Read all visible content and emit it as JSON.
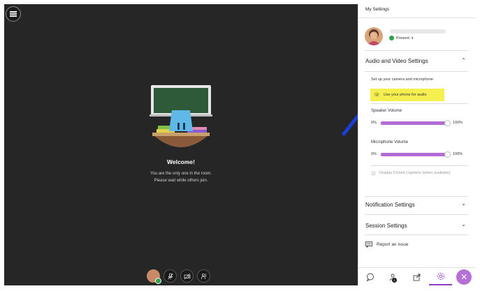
{
  "stage": {
    "welcome_title": "Welcome!",
    "welcome_line1": "You are the only one in the room.",
    "welcome_line2": "Please wait while others join."
  },
  "panel": {
    "title": "My Settings",
    "status": "Present",
    "audio_video_title": "Audio and Video Settings",
    "setup_text": "Set up your camera and microphone",
    "phone_text": "Use your phone for audio",
    "speaker_volume_label": "Speaker Volume",
    "speaker_volume": {
      "min_label": "0%",
      "max_label": "100%",
      "value": 1.0
    },
    "microphone_volume_label": "Microphone Volume",
    "microphone_volume": {
      "min_label": "0%",
      "max_label": "100%",
      "value": 1.0
    },
    "captions_label": "Display Closed Captions (when available)",
    "notification_title": "Notification Settings",
    "session_title": "Session Settings",
    "report_label": "Report an issue",
    "tabs": [
      "chat",
      "attendees",
      "share-content",
      "my-settings"
    ],
    "attendee_count": "1"
  },
  "colors": {
    "accent": "#b36bd6",
    "highlight": "#f5f04f",
    "stage_bg": "#262626",
    "arrow": "#1a3fd6"
  }
}
